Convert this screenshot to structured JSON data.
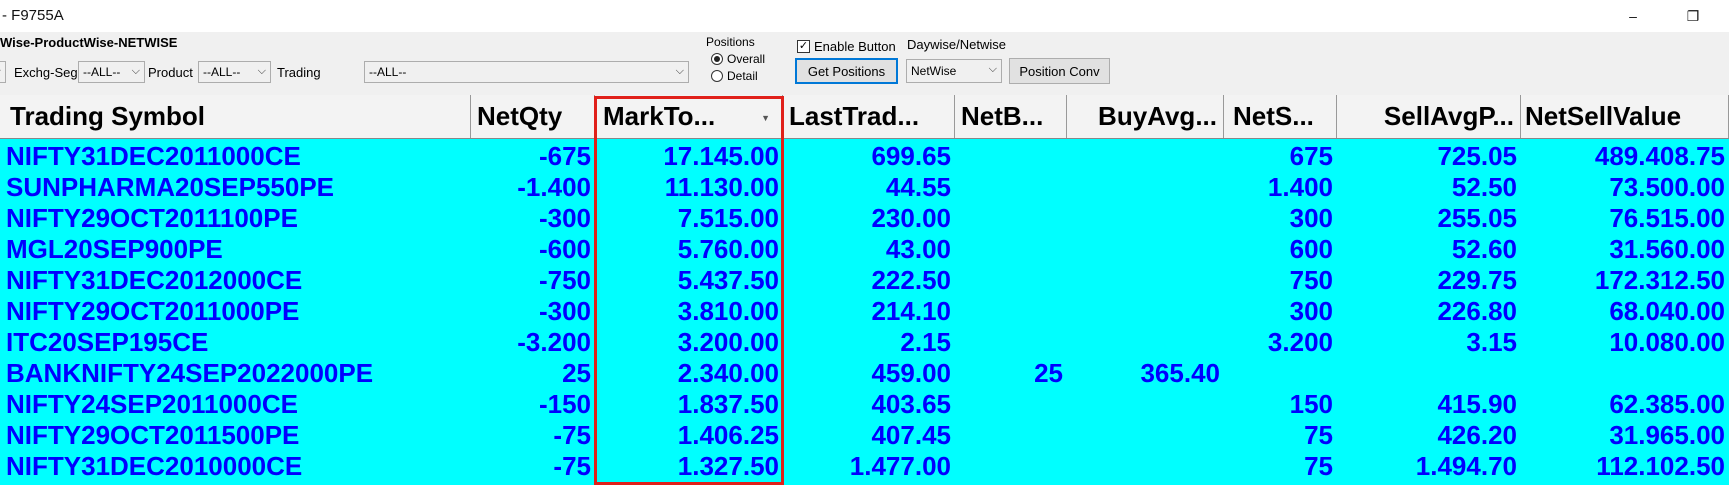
{
  "window": {
    "title": "- F9755A",
    "minimize_glyph": "–",
    "restore_glyph": "❐"
  },
  "toolbar": {
    "heading": "Wise-ProductWise-NETWISE",
    "exchg_seg_label": "Exchg-Seg",
    "exchg_seg_value": "--ALL--",
    "product_label": "Product",
    "product_value": "--ALL--",
    "trading_label": "Trading",
    "trading_value": "--ALL--",
    "positions_label": "Positions",
    "radio_overall": "Overall",
    "radio_detail": "Detail",
    "selected_position": "Overall",
    "enable_button_label": "Enable Button",
    "enable_button_checked": true,
    "get_positions_label": "Get Positions",
    "daywise_label": "Daywise/Netwise",
    "netwise_value": "NetWise",
    "position_conv_label": "Position Conv"
  },
  "table": {
    "columns": [
      "Trading Symbol",
      "NetQty",
      "MarkTo...",
      "LastTrad...",
      "NetB...",
      "BuyAvg...",
      "NetS...",
      "SellAvgP...",
      "NetSellValue"
    ],
    "rows": [
      [
        "NIFTY31DEC2011000CE",
        "-675",
        "17.145.00",
        "699.65",
        "",
        "",
        "675",
        "725.05",
        "489.408.75"
      ],
      [
        "SUNPHARMA20SEP550PE",
        "-1.400",
        "11.130.00",
        "44.55",
        "",
        "",
        "1.400",
        "52.50",
        "73.500.00"
      ],
      [
        "NIFTY29OCT2011100PE",
        "-300",
        "7.515.00",
        "230.00",
        "",
        "",
        "300",
        "255.05",
        "76.515.00"
      ],
      [
        "MGL20SEP900PE",
        "-600",
        "5.760.00",
        "43.00",
        "",
        "",
        "600",
        "52.60",
        "31.560.00"
      ],
      [
        "NIFTY31DEC2012000CE",
        "-750",
        "5.437.50",
        "222.50",
        "",
        "",
        "750",
        "229.75",
        "172.312.50"
      ],
      [
        "NIFTY29OCT2011000PE",
        "-300",
        "3.810.00",
        "214.10",
        "",
        "",
        "300",
        "226.80",
        "68.040.00"
      ],
      [
        "ITC20SEP195CE",
        "-3.200",
        "3.200.00",
        "2.15",
        "",
        "",
        "3.200",
        "3.15",
        "10.080.00"
      ],
      [
        "BANKNIFTY24SEP2022000PE",
        "25",
        "2.340.00",
        "459.00",
        "25",
        "365.40",
        "",
        "",
        ""
      ],
      [
        "NIFTY24SEP2011000CE",
        "-150",
        "1.837.50",
        "403.65",
        "",
        "",
        "150",
        "415.90",
        "62.385.00"
      ],
      [
        "NIFTY29OCT2011500PE",
        "-75",
        "1.406.25",
        "407.45",
        "",
        "",
        "75",
        "426.20",
        "31.965.00"
      ],
      [
        "NIFTY31DEC2010000CE",
        "-75",
        "1.327.50",
        "1.477.00",
        "",
        "",
        "75",
        "1.494.70",
        "112.102.50"
      ]
    ]
  },
  "colors": {
    "grid_bg": "#00ffff",
    "cell_text": "#0000ff",
    "highlight": "#e0201a"
  }
}
